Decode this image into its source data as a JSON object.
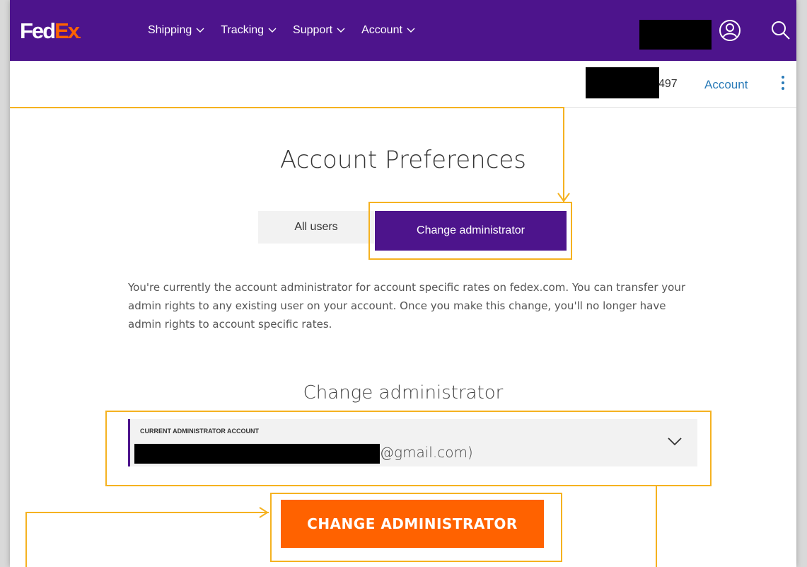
{
  "logo": {
    "part1": "Fed",
    "part2": "Ex",
    "dot": "."
  },
  "nav": {
    "links": [
      {
        "label": "Shipping"
      },
      {
        "label": "Tracking"
      },
      {
        "label": "Support"
      },
      {
        "label": "Account"
      }
    ]
  },
  "subbar": {
    "account_suffix": "497",
    "account_link": "Account"
  },
  "page": {
    "title": "Account Preferences",
    "tabs": [
      {
        "label": "All users"
      },
      {
        "label": "Change administrator"
      }
    ],
    "description": "You're currently the account administrator for account specific rates on fedex.com. You can transfer your admin rights to any existing user on your account. Once you make this change, you'll no longer have admin rights to account specific rates.",
    "section_title": "Change administrator",
    "dropdown": {
      "label": "CURRENT ADMINISTRATOR ACCOUNT",
      "value": "@gmail.com)"
    },
    "cta_label": "CHANGE ADMINISTRATOR"
  },
  "colors": {
    "brand_purple": "#4d148c",
    "brand_orange": "#ff6200",
    "annotation_yellow": "#f5b220",
    "link_blue": "#2a7bb8"
  }
}
